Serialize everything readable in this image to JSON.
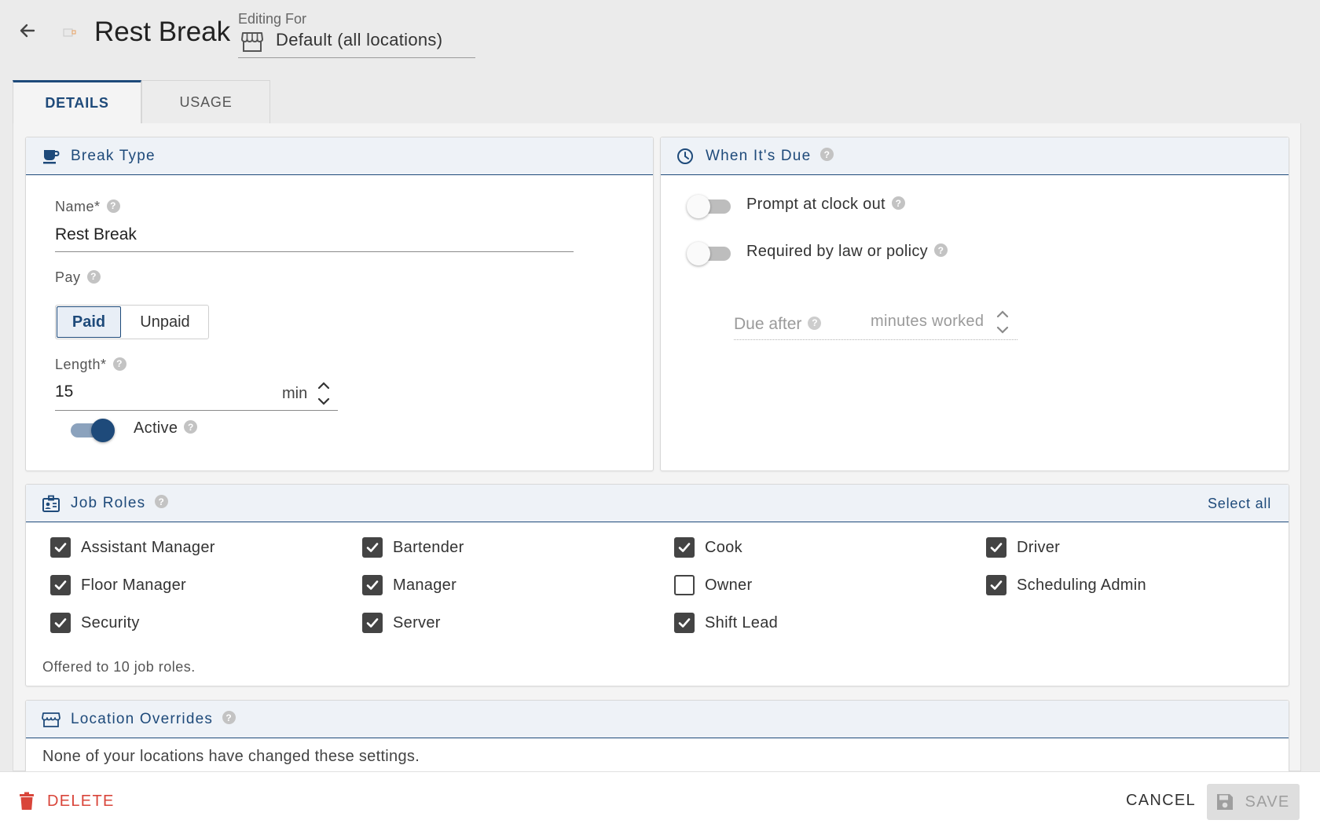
{
  "header": {
    "title": "Rest Break",
    "editing_label": "Editing For",
    "editing_value": "Default (all locations)"
  },
  "tabs": [
    {
      "label": "DETAILS",
      "active": true
    },
    {
      "label": "USAGE",
      "active": false
    }
  ],
  "break_type": {
    "title": "Break Type",
    "name_label": "Name*",
    "name_value": "Rest Break",
    "pay_label": "Pay",
    "pay_options": [
      "Paid",
      "Unpaid"
    ],
    "pay_selected": "Paid",
    "length_label": "Length*",
    "length_value": "15",
    "length_unit": "min",
    "active_label": "Active",
    "active_on": true
  },
  "when_due": {
    "title": "When It's Due",
    "prompt_label": "Prompt at clock out",
    "prompt_on": false,
    "required_label": "Required by law or policy",
    "required_on": false,
    "due_after_label": "Due after",
    "due_after_unit": "minutes worked"
  },
  "job_roles": {
    "title": "Job Roles",
    "select_all": "Select all",
    "roles": [
      {
        "label": "Assistant Manager",
        "checked": true
      },
      {
        "label": "Bartender",
        "checked": true
      },
      {
        "label": "Cook",
        "checked": true
      },
      {
        "label": "Driver",
        "checked": true
      },
      {
        "label": "Floor Manager",
        "checked": true
      },
      {
        "label": "Manager",
        "checked": true
      },
      {
        "label": "Owner",
        "checked": false
      },
      {
        "label": "Scheduling Admin",
        "checked": true
      },
      {
        "label": "Security",
        "checked": true
      },
      {
        "label": "Server",
        "checked": true
      },
      {
        "label": "Shift Lead",
        "checked": true
      }
    ],
    "summary": "Offered to 10 job roles."
  },
  "location_overrides": {
    "title": "Location Overrides",
    "message": "None of your locations have changed these settings."
  },
  "footer": {
    "delete_label": "DELETE",
    "cancel_label": "CANCEL",
    "save_label": "SAVE"
  },
  "colors": {
    "accent": "#1e4a7a",
    "danger": "#d9453a",
    "background": "#ebebeb"
  }
}
